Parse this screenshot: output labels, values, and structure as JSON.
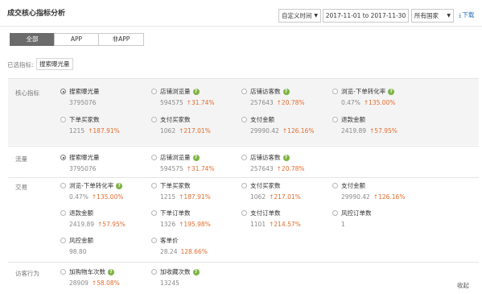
{
  "header": {
    "title": "成交核心指标分析",
    "time_select": "自定义时间",
    "date_range": "2017-11-01 to 2017-11-30",
    "country_select": "所有国家",
    "download": "下载"
  },
  "tabs": [
    {
      "label": "全部",
      "active": true
    },
    {
      "label": "APP",
      "active": false
    },
    {
      "label": "非APP",
      "active": false
    }
  ],
  "selected": {
    "label": "已选指标:",
    "chip": "搜索曝光量"
  },
  "core": {
    "label": "核心指标",
    "metrics": [
      {
        "name": "搜索曝光量",
        "value": "3795076",
        "change": "",
        "help": false,
        "selected": true
      },
      {
        "name": "店铺浏览量",
        "value": "594575",
        "change": "↑31.74%",
        "help": true,
        "selected": false
      },
      {
        "name": "店铺访客数",
        "value": "257643",
        "change": "↑20.78%",
        "help": true,
        "selected": false
      },
      {
        "name": "浏览-下单转化率",
        "value": "0.47%",
        "change": "↑135.00%",
        "help": true,
        "selected": false
      },
      {
        "name": "下单买家数",
        "value": "1215",
        "change": "↑187.91%",
        "help": false,
        "selected": false
      },
      {
        "name": "支付买家数",
        "value": "1062",
        "change": "↑217.01%",
        "help": false,
        "selected": false
      },
      {
        "name": "支付金额",
        "value": "29990.42",
        "change": "↑126.16%",
        "help": false,
        "selected": false
      },
      {
        "name": "退款金额",
        "value": "2419.89",
        "change": "↑57.95%",
        "help": false,
        "selected": false
      }
    ]
  },
  "traffic": {
    "label": "流量",
    "metrics": [
      {
        "name": "搜索曝光量",
        "value": "3795076",
        "change": "",
        "help": false,
        "selected": true
      },
      {
        "name": "店铺浏览量",
        "value": "594575",
        "change": "↑31.74%",
        "help": true,
        "selected": false
      },
      {
        "name": "店铺访客数",
        "value": "257643",
        "change": "↑20.78%",
        "help": true,
        "selected": false
      }
    ]
  },
  "trade": {
    "label": "交易",
    "metrics": [
      {
        "name": "浏览-下单转化率",
        "value": "0.47%",
        "change": "↑135.00%",
        "help": true,
        "selected": false
      },
      {
        "name": "下单买家数",
        "value": "1215",
        "change": "↑187.91%",
        "help": false,
        "selected": false
      },
      {
        "name": "支付买家数",
        "value": "1062",
        "change": "↑217.01%",
        "help": false,
        "selected": false
      },
      {
        "name": "支付金额",
        "value": "29990.42",
        "change": "↑126.16%",
        "help": false,
        "selected": false
      },
      {
        "name": "退款金额",
        "value": "2419.89",
        "change": "↑57.95%",
        "help": false,
        "selected": false
      },
      {
        "name": "下单订单数",
        "value": "1326",
        "change": "↑195.98%",
        "help": false,
        "selected": false
      },
      {
        "name": "支付订单数",
        "value": "1101",
        "change": "↑214.57%",
        "help": false,
        "selected": false
      },
      {
        "name": "风控订单数",
        "value": "1",
        "change": "",
        "help": false,
        "selected": false
      },
      {
        "name": "风控金额",
        "value": "98.80",
        "change": "",
        "help": false,
        "selected": false
      },
      {
        "name": "客单价",
        "value": "28.24",
        "change": "128.66%",
        "help": false,
        "selected": false
      }
    ]
  },
  "visitor": {
    "label": "访客行为",
    "metrics": [
      {
        "name": "加购物车次数",
        "value": "28909",
        "change": "↑58.08%",
        "help": true,
        "selected": false
      },
      {
        "name": "加收藏次数",
        "value": "13245",
        "change": "",
        "help": true,
        "selected": false
      }
    ]
  },
  "footer": {
    "collapse": "收起"
  },
  "colors": {
    "accent_change": "#e46b2c",
    "help_badge": "#7cb342",
    "active_tab": "#6b6b6b",
    "link": "#2f6fb5"
  }
}
